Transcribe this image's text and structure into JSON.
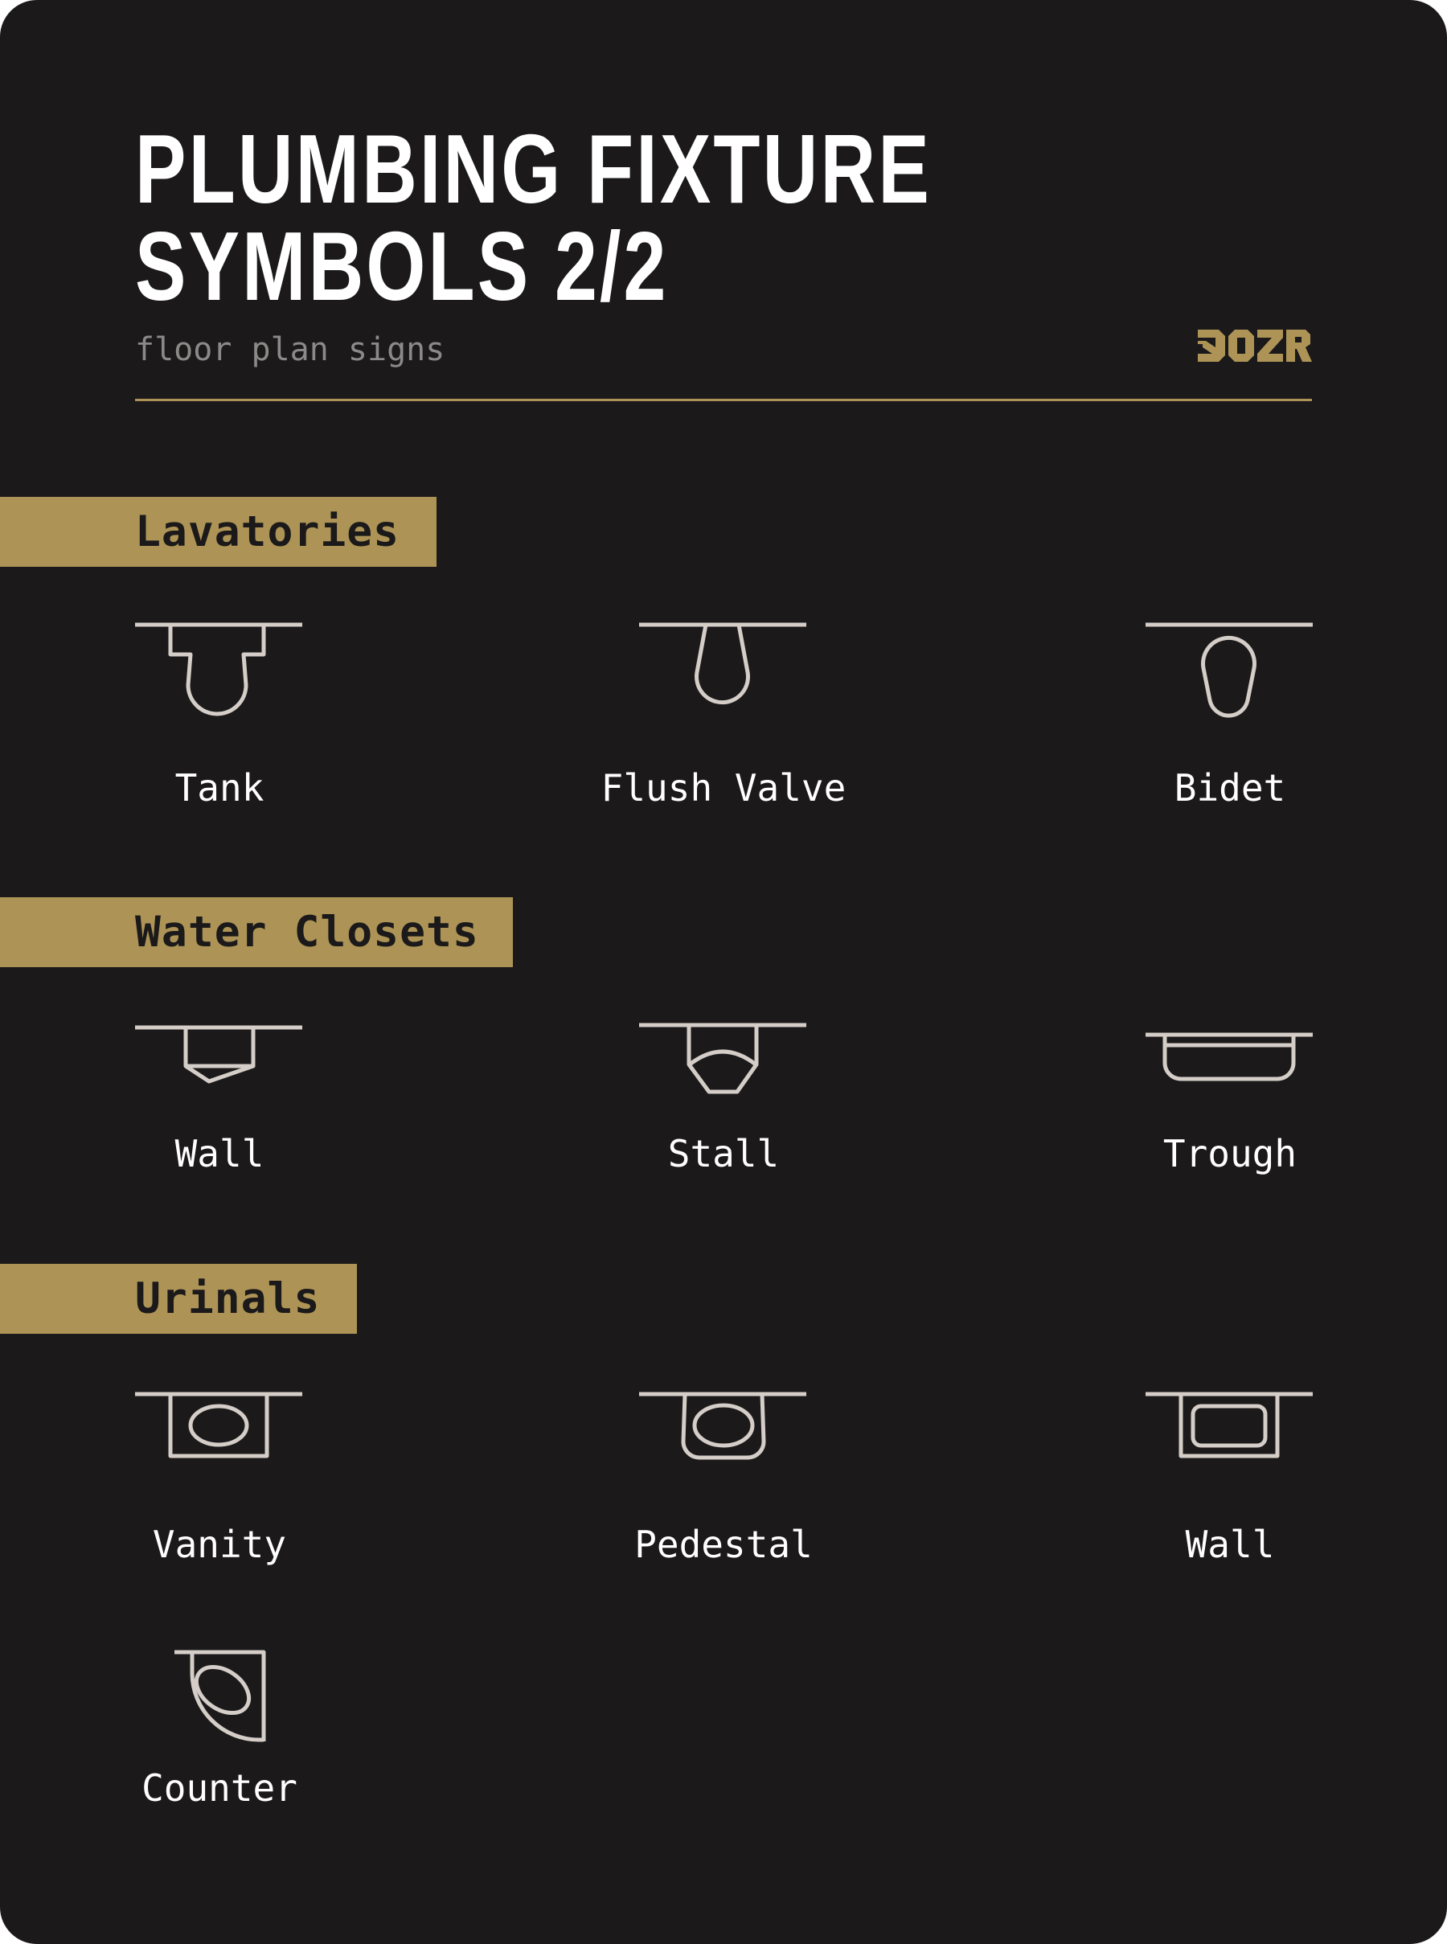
{
  "header": {
    "title_line1": "PLUMBING FIXTURE",
    "title_line2": "SYMBOLS 2/2",
    "subtitle": "floor plan signs",
    "brand_logo": "ZOZR",
    "accent_color": "#ad9456",
    "background_color": "#1b191a"
  },
  "sections": [
    {
      "title": "Lavatories",
      "items": [
        {
          "label": "Tank",
          "icon": "tank-icon"
        },
        {
          "label": "Flush Valve",
          "icon": "flush-valve-icon"
        },
        {
          "label": "Bidet",
          "icon": "bidet-icon"
        }
      ]
    },
    {
      "title": "Water Closets",
      "items": [
        {
          "label": "Wall",
          "icon": "wall-water-closet-icon"
        },
        {
          "label": "Stall",
          "icon": "stall-icon"
        },
        {
          "label": "Trough",
          "icon": "trough-icon"
        }
      ]
    },
    {
      "title": "Urinals",
      "items": [
        {
          "label": "Vanity",
          "icon": "vanity-icon"
        },
        {
          "label": "Pedestal",
          "icon": "pedestal-icon"
        },
        {
          "label": "Wall",
          "icon": "wall-urinal-icon"
        },
        {
          "label": "Counter",
          "icon": "counter-icon"
        }
      ]
    }
  ]
}
